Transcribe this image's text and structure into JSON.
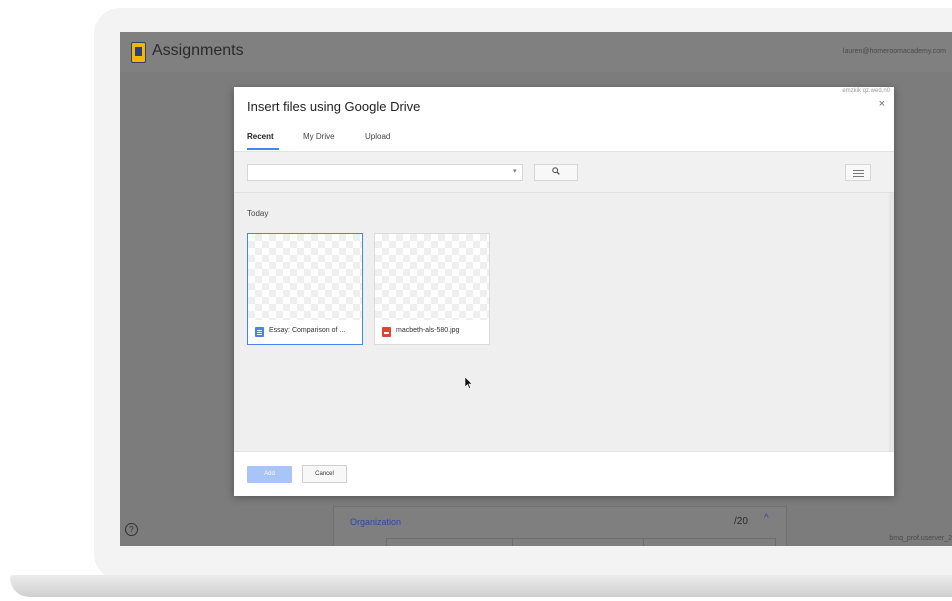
{
  "app": {
    "title": "Assignments",
    "user_email": "lauren@homeroomacademy.com",
    "help_icon": "?",
    "footer_server_text": "bmq_prof.userver_2"
  },
  "background_card": {
    "title": "Organization",
    "score": "/20",
    "chevron": "^"
  },
  "dialog": {
    "title": "Insert files using Google Drive",
    "corner_id": "emzkik qz.wed.n0",
    "close_icon": "×",
    "tabs": [
      {
        "label": "Recent",
        "active": true
      },
      {
        "label": "My Drive",
        "active": false
      },
      {
        "label": "Upload",
        "active": false
      }
    ],
    "search": {
      "placeholder": "",
      "dropdown_icon": "▾",
      "search_icon": "🔍"
    },
    "section_label": "Today",
    "files": [
      {
        "name": "Essay: Comparison of ...",
        "type": "doc",
        "icon": "google-doc-icon",
        "selected": true
      },
      {
        "name": "macbeth-als-580.jpg",
        "type": "image",
        "icon": "image-file-icon",
        "selected": false
      }
    ],
    "buttons": {
      "add": "Add",
      "cancel": "Cancel"
    }
  },
  "colors": {
    "accent": "#4285f4",
    "add_button_disabled": "#a8c4f8",
    "overlay": "#7c7c7c",
    "doc_icon": "#4285f4",
    "image_icon": "#db4437",
    "org_title": "#2d47a5"
  }
}
